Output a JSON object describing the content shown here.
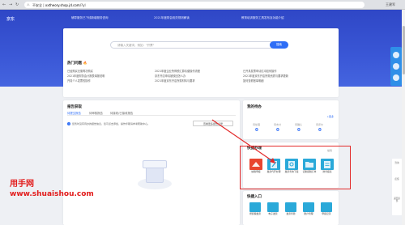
{
  "browser": {
    "back": "←",
    "forward": "→",
    "reload": "↻",
    "lock": "⚠",
    "address_prefix": "不安全 | ",
    "address_domain": "xxtheory.shop.jd.com",
    "address_path": "/?yl",
    "profile_name": "王建军"
  },
  "hero": {
    "brand": "京东",
    "notices": [
      "辅导服务已下线新增服务咨询",
      "2021年度财会相关规则解读",
      "教育培训服务工具发布及功能介绍"
    ]
  },
  "search": {
    "placeholder": "请输入关键词，例如：\"开票\"",
    "button": "搜索"
  },
  "hot": {
    "title": "热门问题",
    "flame": "🔥",
    "items": [
      "已经购买无需再次购买",
      "2021年度财务会计报表填报说明",
      "开具个人发票的操作",
      "2021年度企业所得税汇算清缴操作流程",
      "京东开店申请被驳回怎么办",
      "2021年度京东开店所需材料与要求",
      "已开具发票申请红冲如何操作",
      "2021年度京东开店所需资质与要求更新",
      "如何查看账单明细"
    ]
  },
  "report": {
    "title": "报告获取",
    "tabs": [
      "待提交报告",
      "待审核报告",
      "待接收/已接收报告"
    ],
    "notice_dot": "i",
    "notice": "您暂时没有待办的报告信息，您可点击添加，操作步骤请参考帮助中心。",
    "button": "查看更多报告记录"
  },
  "todo": {
    "title": "我的待办",
    "more": "+更多",
    "items": [
      {
        "label": "待处理",
        "value": "0"
      },
      {
        "label": "待支付",
        "value": "0"
      },
      {
        "label": "待确认",
        "value": "0"
      },
      {
        "label": "待评价",
        "value": "0"
      }
    ]
  },
  "quick": {
    "title": "快捷办理",
    "edit": "编辑",
    "items": [
      {
        "label": "纳税申报",
        "icon": "tax-declare-icon",
        "color": "#e8452f"
      },
      {
        "label": "发票代开办理",
        "icon": "invoice-issue-icon",
        "color": "#2aa9d9"
      },
      {
        "label": "发票查询下载",
        "icon": "invoice-query-icon",
        "color": "#2aa9d9"
      },
      {
        "label": "记账报税订单",
        "icon": "bookkeeping-icon",
        "color": "#2aa9d9"
      },
      {
        "label": "财务报表",
        "icon": "finance-report-icon",
        "color": "#2aa9d9"
      }
    ]
  },
  "entry": {
    "title": "快捷入口",
    "items": [
      {
        "label": "增值税发票",
        "icon": "vat-invoice-icon"
      },
      {
        "label": "电子发票",
        "icon": "e-invoice-icon"
      },
      {
        "label": "发票查验",
        "icon": "invoice-verify-icon"
      },
      {
        "label": "账户管理",
        "icon": "account-manage-icon"
      },
      {
        "label": "申报记录",
        "icon": "declare-record-icon"
      }
    ]
  },
  "watermark": {
    "name": "用手网",
    "url": "www.shuaishou.com"
  },
  "float_tools": [
    "咨询",
    "反馈",
    "返回顶部"
  ]
}
